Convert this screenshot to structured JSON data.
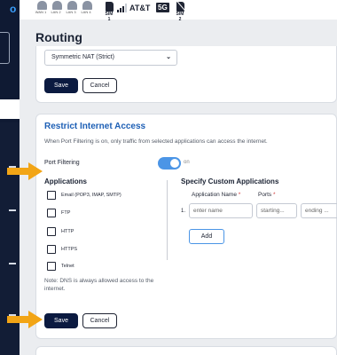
{
  "status_bar": {
    "lan_ports": [
      {
        "label": "WAN 1"
      },
      {
        "label": "LAN 2"
      },
      {
        "label": "LAN 3"
      },
      {
        "label": "LAN 4"
      }
    ],
    "sim1_label": "SIM 1",
    "carrier": "AT&T",
    "network": "5G",
    "sim2_label": "SIM 2"
  },
  "header": {
    "title": "Routing"
  },
  "nat_card": {
    "nat_select_value": "Symmetric NAT (Strict)",
    "save_label": "Save",
    "cancel_label": "Cancel"
  },
  "restrict_card": {
    "title": "Restrict Internet Access",
    "description": "When Port Filtering is on, only traffic from selected applications can access the internet.",
    "port_filtering_label": "Port Filtering",
    "toggle_state_text": "on",
    "applications_heading": "Applications",
    "applications": [
      {
        "label": "Email (POP3, IMAP, SMTP)",
        "checked": false
      },
      {
        "label": "FTP",
        "checked": false
      },
      {
        "label": "HTTP",
        "checked": false
      },
      {
        "label": "HTTPS",
        "checked": false
      },
      {
        "label": "Telnet",
        "checked": false
      }
    ],
    "dns_note": "Note: DNS is always allowed access to the internet.",
    "custom_heading": "Specify Custom Applications",
    "app_name_label": "Application Name",
    "ports_label": "Ports",
    "required_mark": "*",
    "row_number": "1.",
    "name_placeholder": "enter name",
    "start_placeholder": "starting...",
    "end_placeholder": "ending ...",
    "add_label": "Add",
    "save_label": "Save",
    "cancel_label": "Cancel"
  },
  "colors": {
    "sidebar": "#0f1a33",
    "primary_button": "#0b1a40",
    "section_title": "#1d5fb5",
    "toggle_on": "#4b95e6",
    "annotation_arrow": "#f2a516"
  }
}
